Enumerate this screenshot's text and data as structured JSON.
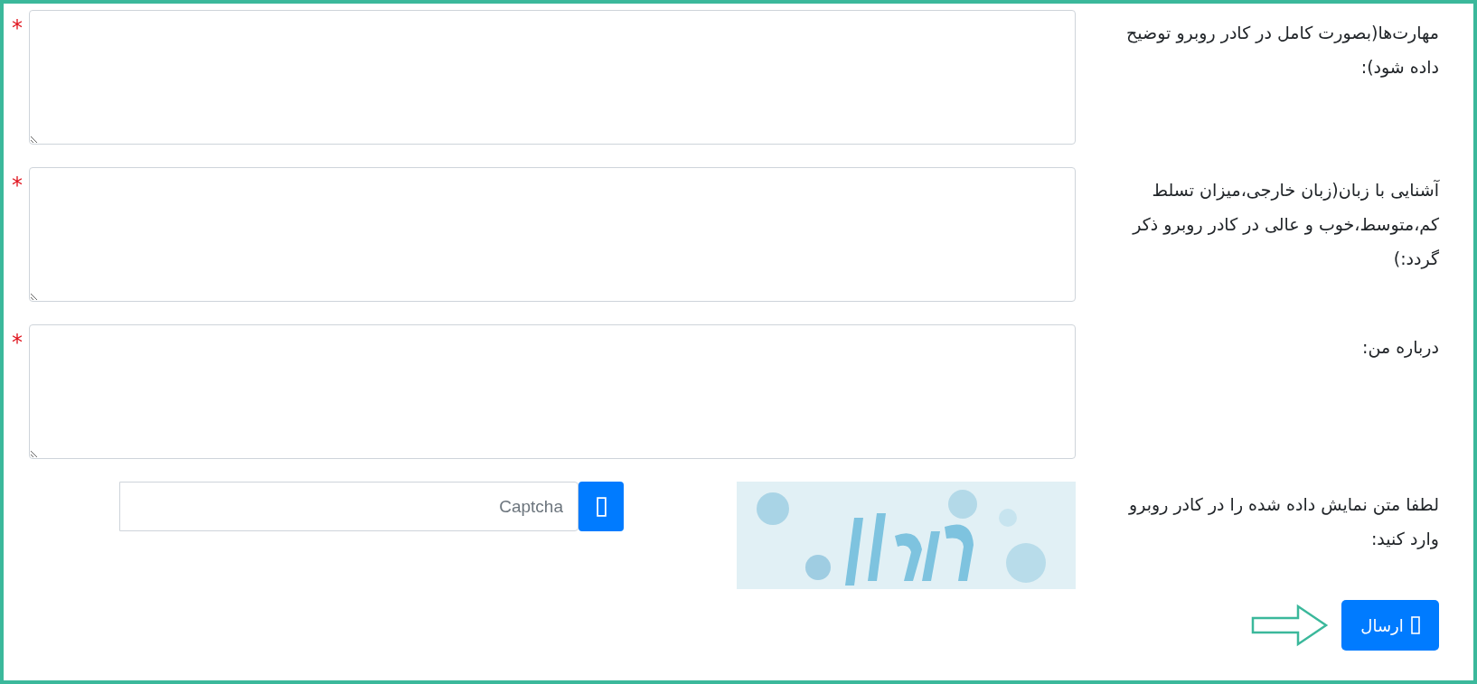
{
  "fields": [
    {
      "kind": "textarea",
      "label": "مهارت‌ها(بصورت کامل در کادر روبرو توضیح داده شود):",
      "required": true,
      "required_mark": "*"
    },
    {
      "kind": "textarea",
      "label": "آشنایی با زبان(زبان خارجی،میزان تسلط کم،متوسط،خوب و عالی در کادر روبرو ذکر گردد:)",
      "required": true,
      "required_mark": "*"
    },
    {
      "kind": "textarea",
      "label": "درباره من:",
      "required": true,
      "required_mark": "*"
    },
    {
      "kind": "captcha",
      "label": "لطفا متن نمایش داده شده را در کادر روبرو وارد کنید:",
      "placeholder": "Captcha"
    }
  ],
  "submit": {
    "label": "ارسال"
  }
}
